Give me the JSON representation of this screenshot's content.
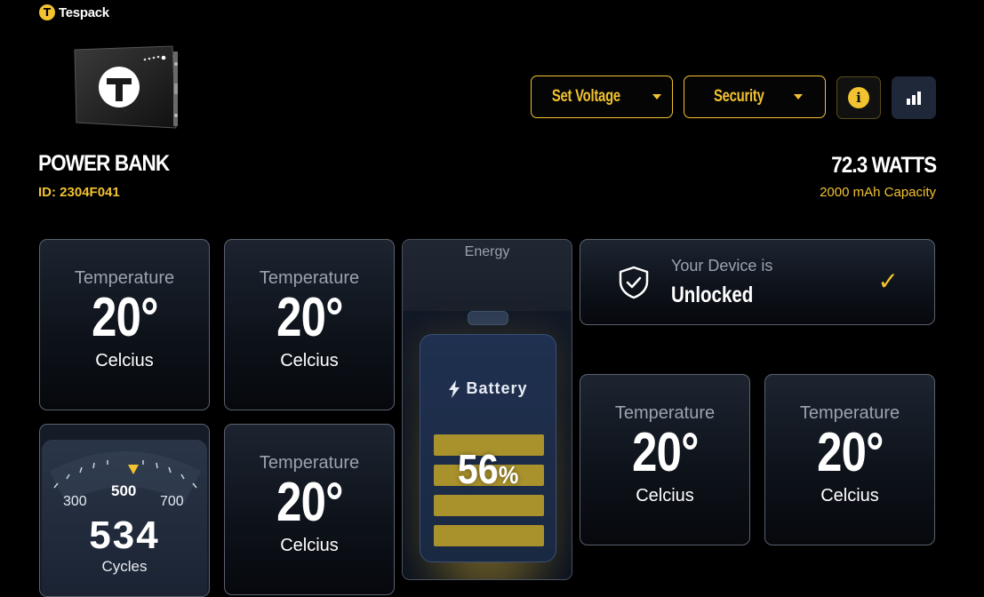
{
  "brand": {
    "name": "Tespack",
    "logo_letter": "T"
  },
  "device": {
    "title": "POWER BANK",
    "id": "ID: 2304F041"
  },
  "power": {
    "watts": "72.3 WATTS",
    "capacity": "2000 mAh Capacity"
  },
  "toolbar": {
    "set_voltage": "Set Voltage",
    "security": "Security",
    "info_glyph": "i",
    "info_icon": "info-icon",
    "stats_icon": "bar-chart-icon"
  },
  "temperature_cards": [
    {
      "label": "Temperature",
      "value": "20°",
      "unit": "Celcius"
    },
    {
      "label": "Temperature",
      "value": "20°",
      "unit": "Celcius"
    },
    {
      "label": "Temperature",
      "value": "20°",
      "unit": "Celcius"
    },
    {
      "label": "Temperature",
      "value": "20°",
      "unit": "Celcius"
    },
    {
      "label": "Temperature",
      "value": "20°",
      "unit": "Celcius"
    }
  ],
  "energy": {
    "label": "Energy",
    "battery_title": "Battery",
    "percent": "56",
    "percent_sign": "%"
  },
  "lock": {
    "subtitle": "Your Device is",
    "state": "Unlocked",
    "check": "✓"
  },
  "cycles": {
    "min_tick": "300",
    "mid_tick": "500",
    "max_tick": "700",
    "value": "534",
    "unit": "Cycles"
  },
  "colors": {
    "accent": "#f2c230",
    "background": "#000000",
    "card": "#131a24"
  }
}
